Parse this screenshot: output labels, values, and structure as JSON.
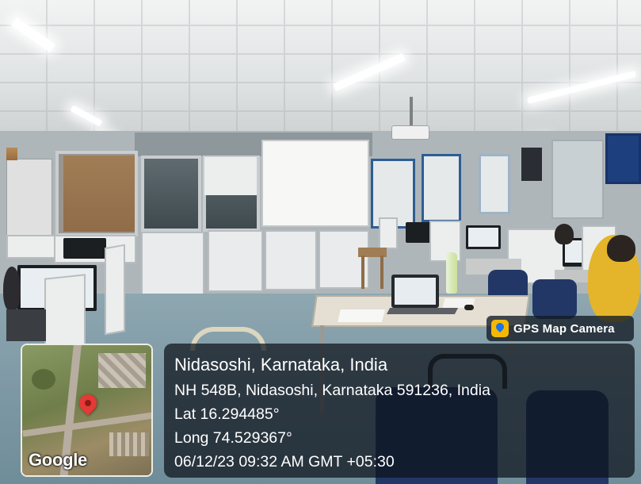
{
  "badge": {
    "label": "GPS Map Camera",
    "icon": "gps-map-camera-app-icon",
    "accent": "#f5b800"
  },
  "stamp": {
    "place": "Nidasoshi, Karnataka, India",
    "address": "NH 548B, Nidasoshi, Karnataka 591236, India",
    "latitude": "Lat 16.294485°",
    "longitude": "Long 74.529367°",
    "datetime": "06/12/23 09:32 AM GMT +05:30"
  },
  "map": {
    "brand": "Google",
    "pin_icon": "location-pin-icon",
    "pin_color": "#e53935"
  }
}
